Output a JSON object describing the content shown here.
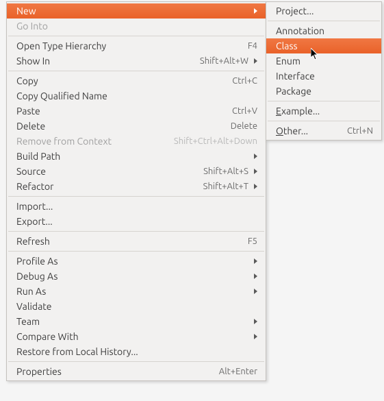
{
  "main_menu": {
    "new": {
      "label": "New",
      "submenu": true,
      "highlighted": true
    },
    "go_into": {
      "label": "Go Into",
      "disabled": true
    },
    "open_type_hierarchy": {
      "label": "Open Type Hierarchy",
      "shortcut": "F4"
    },
    "show_in": {
      "label": "Show In",
      "shortcut": "Shift+Alt+W",
      "submenu": true
    },
    "copy": {
      "label": "Copy",
      "shortcut": "Ctrl+C"
    },
    "copy_qualified_name": {
      "label": "Copy Qualified Name"
    },
    "paste": {
      "label": "Paste",
      "shortcut": "Ctrl+V"
    },
    "delete": {
      "label": "Delete",
      "shortcut": "Delete"
    },
    "remove_from_context": {
      "label": "Remove from Context",
      "shortcut": "Shift+Ctrl+Alt+Down",
      "disabled": true
    },
    "build_path": {
      "label": "Build Path",
      "submenu": true
    },
    "source": {
      "label": "Source",
      "shortcut": "Shift+Alt+S",
      "submenu": true
    },
    "refactor": {
      "label": "Refactor",
      "shortcut": "Shift+Alt+T",
      "submenu": true
    },
    "import": {
      "label": "Import..."
    },
    "export": {
      "label": "Export..."
    },
    "refresh": {
      "label": "Refresh",
      "shortcut": "F5"
    },
    "profile_as": {
      "label": "Profile As",
      "submenu": true
    },
    "debug_as": {
      "label": "Debug As",
      "submenu": true
    },
    "run_as": {
      "label": "Run As",
      "submenu": true
    },
    "validate": {
      "label": "Validate"
    },
    "team": {
      "label": "Team",
      "submenu": true
    },
    "compare_with": {
      "label": "Compare With",
      "submenu": true
    },
    "restore_local_history": {
      "label": "Restore from Local History..."
    },
    "properties": {
      "label": "Properties",
      "shortcut": "Alt+Enter"
    }
  },
  "sub_menu": {
    "project": {
      "label": "Project...",
      "mnemonic_index": -1
    },
    "annotation": {
      "label": "Annotation"
    },
    "class": {
      "label": "Class",
      "highlighted": true
    },
    "enum": {
      "label": "Enum"
    },
    "interface": {
      "label": "Interface"
    },
    "package": {
      "label": "Package"
    },
    "example": {
      "label": "Example...",
      "mnemonic": "E"
    },
    "other": {
      "label": "Other...",
      "shortcut": "Ctrl+N",
      "mnemonic": "O"
    }
  },
  "colors": {
    "highlight": "#e96229",
    "text": "#3c3c3c",
    "disabled": "#a0a0a0",
    "menu_bg": "#f2f1f0"
  }
}
